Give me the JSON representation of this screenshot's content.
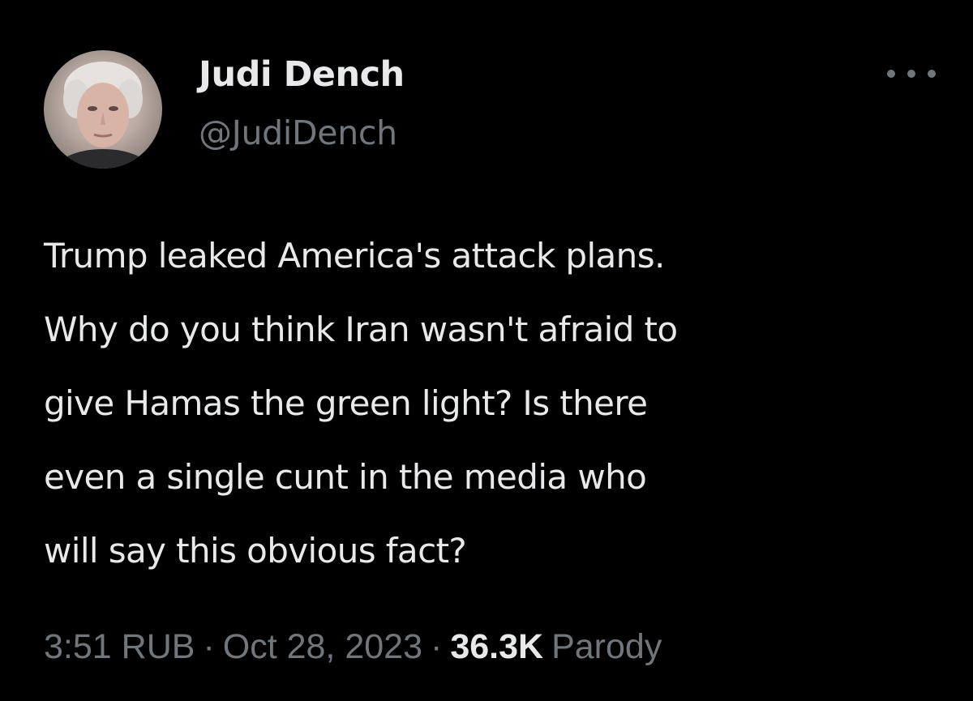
{
  "author": {
    "display_name": "Judi Dench",
    "handle": "@JudiDench"
  },
  "tweet": {
    "text": "Trump leaked America's attack plans.\nWhy do you think Iran wasn't afraid to\ngive Hamas the green light? Is there\neven a single cunt in the media who\nwill say this obvious fact?"
  },
  "meta": {
    "time": "3:51 RUB",
    "separator": "·",
    "date": "Oct 28, 2023",
    "views_count": "36.3K",
    "views_label": "Parody"
  },
  "icons": {
    "more": "more-horizontal-icon",
    "avatar": "profile-photo"
  },
  "colors": {
    "background": "#000000",
    "primary_text": "#e7e9ea",
    "secondary_text": "#71767b"
  }
}
